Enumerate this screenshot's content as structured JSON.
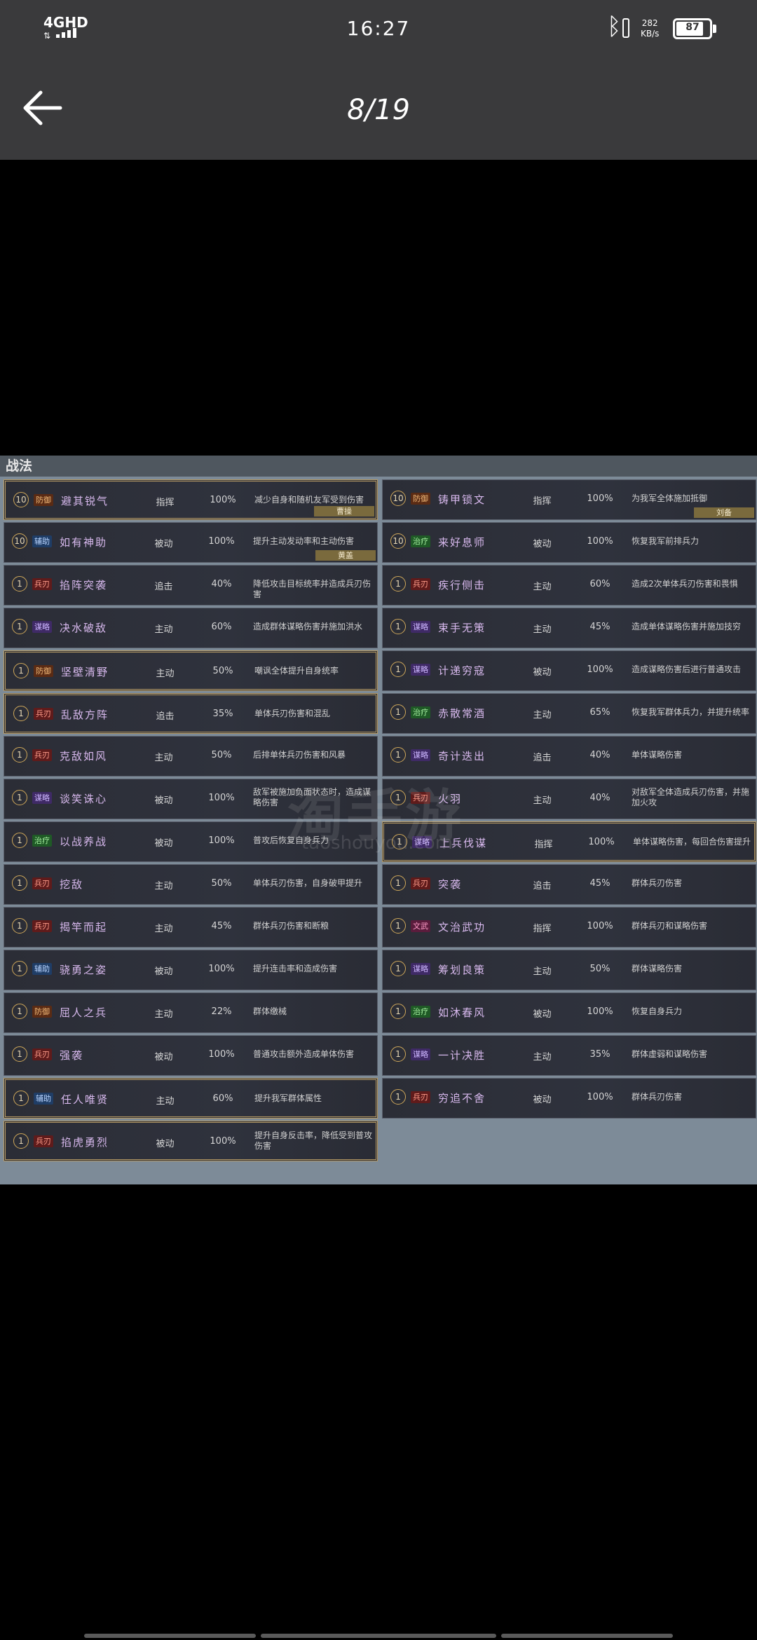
{
  "status_bar": {
    "network": "4GHD",
    "time": "16:27",
    "speed_value": "282",
    "speed_unit": "KB/s",
    "battery": "87"
  },
  "viewer": {
    "page_counter": "8/19"
  },
  "sheet": {
    "header": "战法",
    "left_column": [
      {
        "level": "10",
        "tag": "防御",
        "tag_style": "fang",
        "name": "避其锐气",
        "kind": "指挥",
        "rate": "100%",
        "desc": "减少自身和随机友军受到伤害",
        "commander": "曹操",
        "framed": true
      },
      {
        "level": "10",
        "tag": "辅助",
        "tag_style": "fu",
        "name": "如有神助",
        "kind": "被动",
        "rate": "100%",
        "desc": "提升主动发动率和主动伤害",
        "commander": "黄盖",
        "framed": false
      },
      {
        "level": "1",
        "tag": "兵刃",
        "tag_style": "bing",
        "name": "掐阵突袭",
        "kind": "追击",
        "rate": "40%",
        "desc": "降低攻击目标统率并造成兵刃伤害",
        "framed": false
      },
      {
        "level": "1",
        "tag": "谋略",
        "tag_style": "mou",
        "name": "决水破敌",
        "kind": "主动",
        "rate": "60%",
        "desc": "造成群体谋略伤害并施加洪水",
        "framed": false
      },
      {
        "level": "1",
        "tag": "防御",
        "tag_style": "fang",
        "name": "坚壁清野",
        "kind": "主动",
        "rate": "50%",
        "desc": "嘲讽全体提升自身统率",
        "framed": true
      },
      {
        "level": "1",
        "tag": "兵刃",
        "tag_style": "bing",
        "name": "乱敌方阵",
        "kind": "追击",
        "rate": "35%",
        "desc": "单体兵刃伤害和混乱",
        "framed": true
      },
      {
        "level": "1",
        "tag": "兵刃",
        "tag_style": "bing",
        "name": "克敌如风",
        "kind": "主动",
        "rate": "50%",
        "desc": "后排单体兵刃伤害和风暴",
        "framed": false
      },
      {
        "level": "1",
        "tag": "谋略",
        "tag_style": "mou",
        "name": "谈笑诛心",
        "kind": "被动",
        "rate": "100%",
        "desc": "敌军被施加负面状态时，造成谋略伤害",
        "framed": false
      },
      {
        "level": "1",
        "tag": "治疗",
        "tag_style": "zhi",
        "name": "以战养战",
        "kind": "被动",
        "rate": "100%",
        "desc": "普攻后恢复自身兵力",
        "framed": false
      },
      {
        "level": "1",
        "tag": "兵刃",
        "tag_style": "bing",
        "name": "挖敌",
        "kind": "主动",
        "rate": "50%",
        "desc": "单体兵刃伤害，自身破甲提升",
        "framed": false
      },
      {
        "level": "1",
        "tag": "兵刃",
        "tag_style": "bing",
        "name": "揭竿而起",
        "kind": "主动",
        "rate": "45%",
        "desc": "群体兵刃伤害和断粮",
        "framed": false
      },
      {
        "level": "1",
        "tag": "辅助",
        "tag_style": "fu",
        "name": "骁勇之姿",
        "kind": "被动",
        "rate": "100%",
        "desc": "提升连击率和造成伤害",
        "framed": false
      },
      {
        "level": "1",
        "tag": "防御",
        "tag_style": "fang",
        "name": "屈人之兵",
        "kind": "主动",
        "rate": "22%",
        "desc": "群体缴械",
        "framed": false
      },
      {
        "level": "1",
        "tag": "兵刃",
        "tag_style": "bing",
        "name": "强袭",
        "kind": "被动",
        "rate": "100%",
        "desc": "普通攻击额外造成单体伤害",
        "framed": false
      },
      {
        "level": "1",
        "tag": "辅助",
        "tag_style": "fu",
        "name": "任人唯贤",
        "kind": "主动",
        "rate": "60%",
        "desc": "提升我军群体属性",
        "framed": true
      },
      {
        "level": "1",
        "tag": "兵刃",
        "tag_style": "bing",
        "name": "掐虎勇烈",
        "kind": "被动",
        "rate": "100%",
        "desc": "提升自身反击率，降低受到普攻伤害",
        "framed": true
      }
    ],
    "right_column": [
      {
        "level": "10",
        "tag": "防御",
        "tag_style": "fang",
        "name": "铸甲锁文",
        "kind": "指挥",
        "rate": "100%",
        "desc": "为我军全体施加抵御",
        "commander": "刘备",
        "framed": false
      },
      {
        "level": "10",
        "tag": "治疗",
        "tag_style": "zhi",
        "name": "来好息师",
        "kind": "被动",
        "rate": "100%",
        "desc": "恢复我军前排兵力",
        "framed": false
      },
      {
        "level": "1",
        "tag": "兵刃",
        "tag_style": "bing",
        "name": "疾行侧击",
        "kind": "主动",
        "rate": "60%",
        "desc": "造成2次单体兵刃伤害和畏惧",
        "framed": false
      },
      {
        "level": "1",
        "tag": "谋略",
        "tag_style": "mou",
        "name": "束手无策",
        "kind": "主动",
        "rate": "45%",
        "desc": "造成单体谋略伤害并施加技穷",
        "framed": false
      },
      {
        "level": "1",
        "tag": "谋略",
        "tag_style": "mou",
        "name": "计递穷寇",
        "kind": "被动",
        "rate": "100%",
        "desc": "造成谋略伤害后进行普通攻击",
        "framed": false
      },
      {
        "level": "1",
        "tag": "治疗",
        "tag_style": "zhi",
        "name": "赤散常酒",
        "kind": "主动",
        "rate": "65%",
        "desc": "恢复我军群体兵力，并提升统率",
        "framed": false
      },
      {
        "level": "1",
        "tag": "谋略",
        "tag_style": "mou",
        "name": "奇计迭出",
        "kind": "追击",
        "rate": "40%",
        "desc": "单体谋略伤害",
        "framed": false
      },
      {
        "level": "1",
        "tag": "兵刃",
        "tag_style": "bing",
        "name": "火羽",
        "kind": "主动",
        "rate": "40%",
        "desc": "对敌军全体造成兵刃伤害，并施加火攻",
        "framed": false
      },
      {
        "level": "1",
        "tag": "谋略",
        "tag_style": "mou",
        "name": "上兵伐谋",
        "kind": "指挥",
        "rate": "100%",
        "desc": "单体谋略伤害，每回合伤害提升",
        "framed": true
      },
      {
        "level": "1",
        "tag": "兵刃",
        "tag_style": "bing",
        "name": "突袭",
        "kind": "追击",
        "rate": "45%",
        "desc": "群体兵刃伤害",
        "framed": false
      },
      {
        "level": "1",
        "tag": "文武",
        "tag_style": "wen",
        "name": "文治武功",
        "kind": "指挥",
        "rate": "100%",
        "desc": "群体兵刃和谋略伤害",
        "framed": false
      },
      {
        "level": "1",
        "tag": "谋略",
        "tag_style": "mou",
        "name": "筹划良策",
        "kind": "主动",
        "rate": "50%",
        "desc": "群体谋略伤害",
        "framed": false
      },
      {
        "level": "1",
        "tag": "治疗",
        "tag_style": "zhi",
        "name": "如沐春风",
        "kind": "被动",
        "rate": "100%",
        "desc": "恢复自身兵力",
        "framed": false
      },
      {
        "level": "1",
        "tag": "谋略",
        "tag_style": "mou",
        "name": "一计决胜",
        "kind": "主动",
        "rate": "35%",
        "desc": "群体虚弱和谋略伤害",
        "framed": false
      },
      {
        "level": "1",
        "tag": "兵刃",
        "tag_style": "bing",
        "name": "穷追不舍",
        "kind": "被动",
        "rate": "100%",
        "desc": "群体兵刃伤害",
        "framed": false
      }
    ]
  },
  "watermark": {
    "main": "淘手游",
    "sub": "taoshouyou.com"
  }
}
